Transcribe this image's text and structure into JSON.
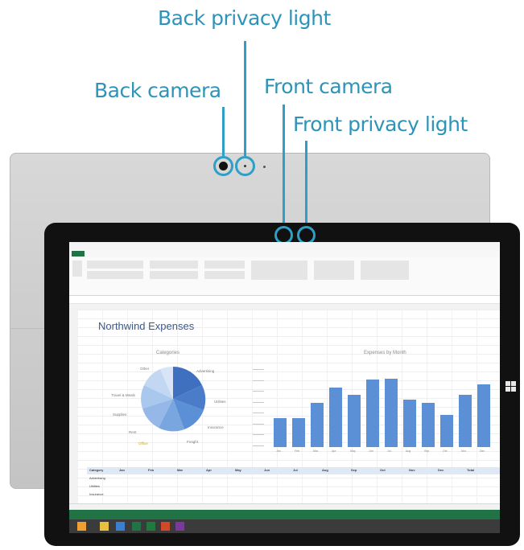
{
  "callouts": {
    "back_privacy_light": "Back privacy light",
    "back_camera": "Back camera",
    "front_camera": "Front camera",
    "front_privacy_light": "Front privacy light"
  },
  "colors": {
    "callout_text": "#2e93b8",
    "callout_ring": "#2ea0c8",
    "excel_green": "#217346",
    "bar_blue": "#5b8fd6"
  },
  "screen": {
    "sheet_title": "Northwind Expenses",
    "pie_chart": {
      "title": "Categories",
      "labels": [
        "Advertising",
        "Other",
        "Utilities",
        "Travel & Meals",
        "Insurance",
        "Supplies",
        "Freight",
        "Rent",
        "Office"
      ]
    },
    "bar_chart": {
      "title": "Expenses by Month",
      "months": [
        "Jan",
        "Feb",
        "Mar",
        "Apr",
        "May",
        "Jun",
        "Jul",
        "Aug",
        "Sep",
        "Oct",
        "Nov",
        "Dec"
      ],
      "relative_heights": [
        0.38,
        0.38,
        0.58,
        0.78,
        0.68,
        0.88,
        0.9,
        0.62,
        0.58,
        0.42,
        0.68,
        0.82
      ]
    },
    "table_header": [
      "Category",
      "Jan",
      "Feb",
      "Mar",
      "Apr",
      "May",
      "Jun",
      "Jul",
      "Aug",
      "Sep",
      "Oct",
      "Nov",
      "Dec",
      "Total"
    ],
    "table_rows": [
      "Advertising",
      "Utilities",
      "Insurance"
    ]
  },
  "icons": [
    "windows-logo-icon",
    "excel-icon",
    "file-explorer-icon",
    "ie-icon"
  ]
}
